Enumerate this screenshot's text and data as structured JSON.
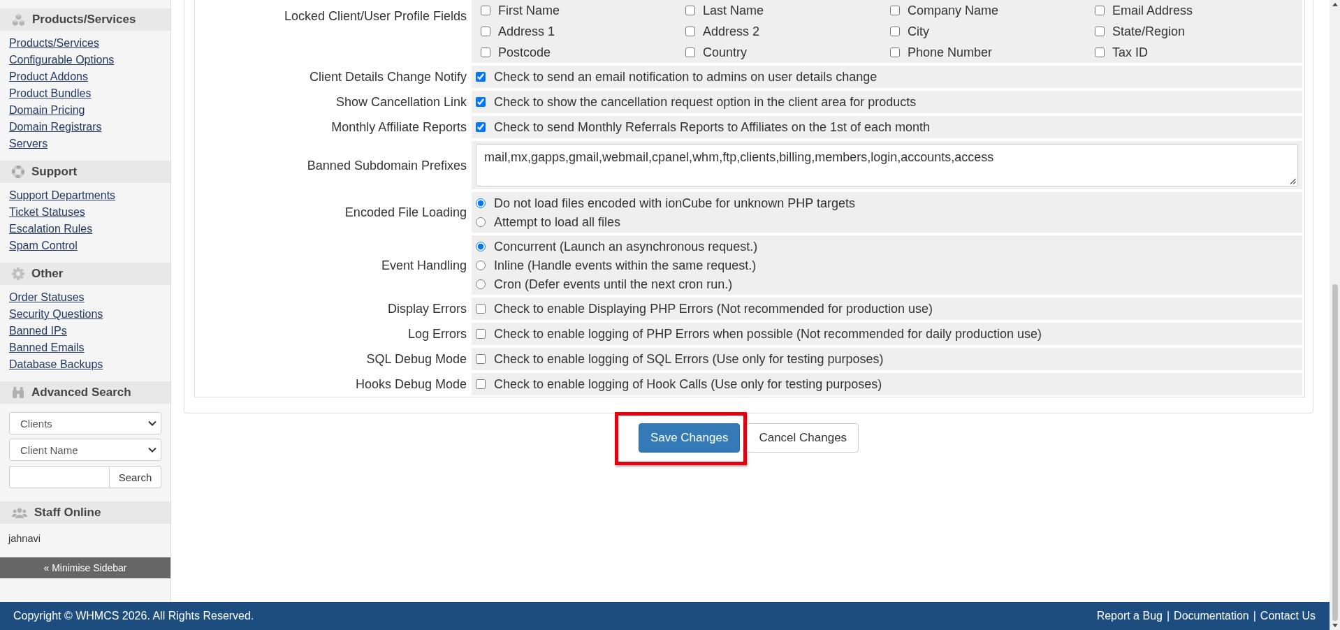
{
  "sidebar": {
    "sections": [
      {
        "title": "Products/Services",
        "links": [
          "Products/Services",
          "Configurable Options",
          "Product Addons",
          "Product Bundles",
          "Domain Pricing",
          "Domain Registrars",
          "Servers"
        ]
      },
      {
        "title": "Support",
        "links": [
          "Support Departments",
          "Ticket Statuses",
          "Escalation Rules",
          "Spam Control"
        ]
      },
      {
        "title": "Other",
        "links": [
          "Order Statuses",
          "Security Questions",
          "Banned IPs",
          "Banned Emails",
          "Database Backups"
        ]
      }
    ],
    "advanced_search": {
      "title": "Advanced Search",
      "selects": [
        {
          "value": "Clients"
        },
        {
          "value": "Client Name"
        }
      ],
      "search_button": "Search"
    },
    "staff_online": {
      "title": "Staff Online",
      "users": [
        "jahnavi"
      ]
    },
    "minimise_button": "« Minimise Sidebar"
  },
  "settings": {
    "rows": [
      {
        "kind": "checkbox_grid",
        "label": "Locked Client/User Profile Fields",
        "options": [
          {
            "label": "First Name",
            "checked": false
          },
          {
            "label": "Last Name",
            "checked": false
          },
          {
            "label": "Company Name",
            "checked": false
          },
          {
            "label": "Email Address",
            "checked": false
          },
          {
            "label": "Address 1",
            "checked": false
          },
          {
            "label": "Address 2",
            "checked": false
          },
          {
            "label": "City",
            "checked": false
          },
          {
            "label": "State/Region",
            "checked": false
          },
          {
            "label": "Postcode",
            "checked": false
          },
          {
            "label": "Country",
            "checked": false
          },
          {
            "label": "Phone Number",
            "checked": false
          },
          {
            "label": "Tax ID",
            "checked": false
          }
        ]
      },
      {
        "kind": "checkbox",
        "label": "Client Details Change Notify",
        "checked": true,
        "text": "Check to send an email notification to admins on user details change"
      },
      {
        "kind": "checkbox",
        "label": "Show Cancellation Link",
        "checked": true,
        "text": "Check to show the cancellation request option in the client area for products"
      },
      {
        "kind": "checkbox",
        "label": "Monthly Affiliate Reports",
        "checked": true,
        "text": "Check to send Monthly Referrals Reports to Affiliates on the 1st of each month"
      },
      {
        "kind": "textarea",
        "label": "Banned Subdomain Prefixes",
        "value": "mail,mx,gapps,gmail,webmail,cpanel,whm,ftp,clients,billing,members,login,accounts,access"
      },
      {
        "kind": "radio",
        "label": "Encoded File Loading",
        "options": [
          {
            "label": "Do not load files encoded with ionCube for unknown PHP targets",
            "selected": true
          },
          {
            "label": "Attempt to load all files",
            "selected": false
          }
        ]
      },
      {
        "kind": "radio",
        "label": "Event Handling",
        "options": [
          {
            "label": "Concurrent (Launch an asynchronous request.)",
            "selected": true
          },
          {
            "label": "Inline (Handle events within the same request.)",
            "selected": false
          },
          {
            "label": "Cron (Defer events until the next cron run.)",
            "selected": false
          }
        ]
      },
      {
        "kind": "checkbox",
        "label": "Display Errors",
        "checked": false,
        "text": "Check to enable Displaying PHP Errors (Not recommended for production use)"
      },
      {
        "kind": "checkbox",
        "label": "Log Errors",
        "checked": false,
        "text": "Check to enable logging of PHP Errors when possible (Not recommended for daily production use)"
      },
      {
        "kind": "checkbox",
        "label": "SQL Debug Mode",
        "checked": false,
        "text": "Check to enable logging of SQL Errors (Use only for testing purposes)"
      },
      {
        "kind": "checkbox",
        "label": "Hooks Debug Mode",
        "checked": false,
        "text": "Check to enable logging of Hook Calls (Use only for testing purposes)"
      }
    ]
  },
  "buttons": [
    {
      "label": "Save Changes",
      "kind": "primary",
      "highlighted": true
    },
    {
      "label": "Cancel Changes",
      "kind": "default",
      "highlighted": false
    }
  ],
  "footer": {
    "copyright": "Copyright © WHMCS 2026. All Rights Reserved.",
    "links": [
      "Report a Bug",
      "Documentation",
      "Contact Us"
    ],
    "separators": [
      "|",
      "|"
    ]
  }
}
